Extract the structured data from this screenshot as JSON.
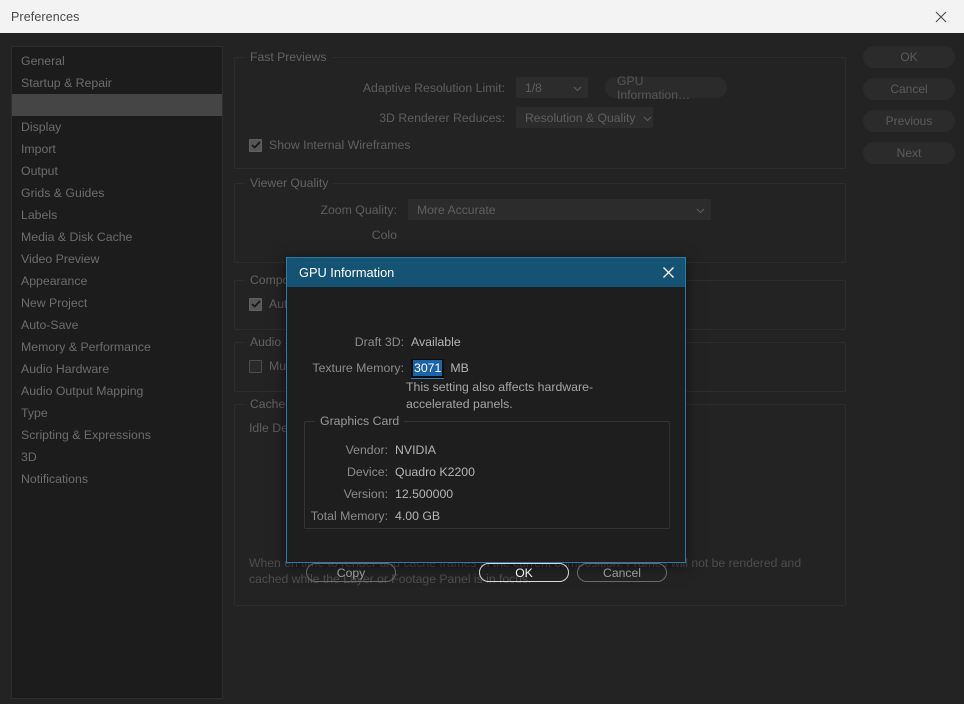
{
  "window": {
    "title": "Preferences",
    "close_icon": "close-icon"
  },
  "sidebar": {
    "items": [
      {
        "label": "General",
        "selected": false
      },
      {
        "label": "Startup & Repair",
        "selected": false
      },
      {
        "label": "",
        "selected": true
      },
      {
        "label": "Display",
        "selected": false
      },
      {
        "label": "Import",
        "selected": false
      },
      {
        "label": "Output",
        "selected": false
      },
      {
        "label": "Grids & Guides",
        "selected": false
      },
      {
        "label": "Labels",
        "selected": false
      },
      {
        "label": "Media & Disk Cache",
        "selected": false
      },
      {
        "label": "Video Preview",
        "selected": false
      },
      {
        "label": "Appearance",
        "selected": false
      },
      {
        "label": "New Project",
        "selected": false
      },
      {
        "label": "Auto-Save",
        "selected": false
      },
      {
        "label": "Memory & Performance",
        "selected": false
      },
      {
        "label": "Audio Hardware",
        "selected": false
      },
      {
        "label": "Audio Output Mapping",
        "selected": false
      },
      {
        "label": "Type",
        "selected": false
      },
      {
        "label": "Scripting & Expressions",
        "selected": false
      },
      {
        "label": "3D",
        "selected": false
      },
      {
        "label": "Notifications",
        "selected": false
      }
    ]
  },
  "actions": {
    "ok": "OK",
    "cancel": "Cancel",
    "previous": "Previous",
    "next": "Next"
  },
  "content": {
    "fast_previews": {
      "legend": "Fast Previews",
      "adaptive_resolution_label": "Adaptive Resolution Limit:",
      "adaptive_resolution_value": "1/8",
      "gpu_info_button": "GPU Information…",
      "renderer_reduces_label": "3D Renderer Reduces:",
      "renderer_reduces_value": "Resolution & Quality",
      "wireframes_label": "Show Internal Wireframes",
      "wireframes_checked": true
    },
    "viewer_quality": {
      "legend": "Viewer Quality",
      "zoom_quality_label": "Zoom Quality:",
      "zoom_quality_value": "More Accurate",
      "color_label": "Colo"
    },
    "compositing": {
      "legend": "Composit",
      "auto_label": "Auto",
      "auto_checked": true
    },
    "audio": {
      "legend": "Audio",
      "mute_label": "Mute",
      "mute_checked": false
    },
    "cache_frames": {
      "legend": "Cache Fra",
      "idle_delay_label": "Idle Del",
      "description": "When en                                          time to render and cache frames in the current composition. Frames will not be rendered and cached while the Layer or Footage Panel is in focus."
    }
  },
  "gpu_dialog": {
    "title": "GPU Information",
    "close_icon": "close-icon",
    "draft3d_label": "Draft 3D:",
    "draft3d_value": "Available",
    "texture_memory_label": "Texture Memory:",
    "texture_memory_value": "3071",
    "texture_memory_unit": "MB",
    "texture_memory_note": "This setting also affects hardware-accelerated panels.",
    "graphics_card": {
      "legend": "Graphics Card",
      "rows": [
        {
          "label": "Vendor:",
          "value": "NVIDIA"
        },
        {
          "label": "Device:",
          "value": "Quadro K2200"
        },
        {
          "label": "Version:",
          "value": "12.500000"
        },
        {
          "label": "Total Memory:",
          "value": "4.00 GB"
        }
      ]
    },
    "buttons": {
      "copy": "Copy",
      "ok": "OK",
      "cancel": "Cancel"
    }
  },
  "colors": {
    "window_bg": "#232323",
    "titlebar_bg": "#f3f3f3",
    "sidebar_bg": "#1c1c1c",
    "selection_row": "#454545",
    "dialog_bg": "#1e1e1e",
    "dialog_title_bg": "#145374",
    "dialog_border": "#2c7aa8",
    "text_selection": "#1b63a8",
    "focus_underline": "#2f7fb5"
  }
}
